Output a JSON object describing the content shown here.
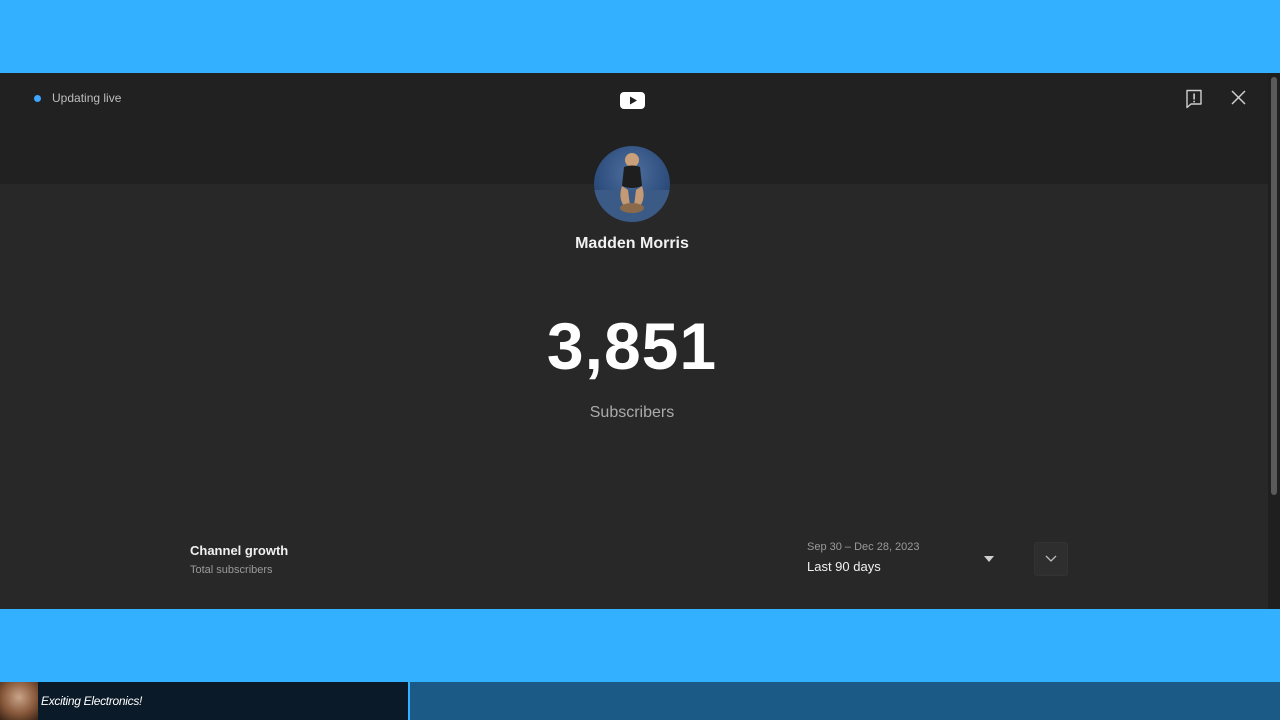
{
  "status": {
    "live_text": "Updating live"
  },
  "channel": {
    "name": "Madden Morris",
    "subscriber_count": "3,851",
    "subscriber_label": "Subscribers"
  },
  "growth": {
    "title": "Channel growth",
    "subtitle": "Total subscribers",
    "date_range": "Sep 30 – Dec 28, 2023",
    "range_label": "Last 90 days"
  },
  "bottom_bar": {
    "title": "Exciting Electronics!"
  },
  "icons": {
    "logo": "youtube-logo-icon",
    "feedback": "feedback-icon",
    "close": "close-icon",
    "caret": "caret-down-icon",
    "expand": "chevron-down-icon"
  },
  "colors": {
    "background_blue": "#33b0ff",
    "panel_dark": "#282828",
    "live_dot": "#3ea6ff",
    "text_primary": "#f1f1f1",
    "text_secondary": "#aaaaaa"
  }
}
